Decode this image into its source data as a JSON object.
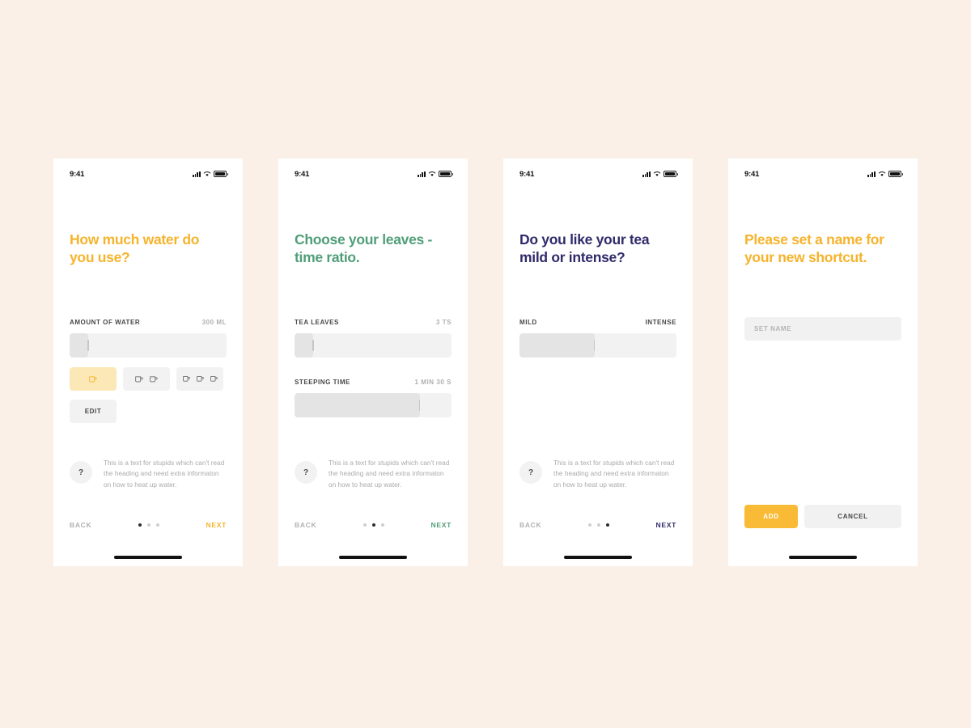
{
  "background_color": "#FBF0E8",
  "colors": {
    "amber": "#F6B32C",
    "green": "#4F9E78",
    "navy": "#302B6B",
    "selected_cup_bg": "#FCE8B6",
    "track": "#F2F2F2",
    "fill": "#E4E4E4"
  },
  "status_bar": {
    "time": "9:41"
  },
  "help_text": "This is a text for stupids which can't read the heading and need extra informaton on how to heat up water.",
  "help_badge": "?",
  "screens": [
    {
      "id": "water-amount",
      "accent": "#F6B32C",
      "heading": "How much water do you use?",
      "fields": [
        {
          "label": "AMOUNT OF WATER",
          "value": "300 ML",
          "fill_percent": 12,
          "thumb_percent": 12
        }
      ],
      "cup_options": [
        {
          "count": 1,
          "selected": true
        },
        {
          "count": 2,
          "selected": false
        },
        {
          "count": 3,
          "selected": false
        }
      ],
      "edit_label": "EDIT",
      "back_label": "BACK",
      "next_label": "NEXT",
      "dots": {
        "total": 3,
        "active_index": 0
      }
    },
    {
      "id": "leaves-time-ratio",
      "accent": "#4F9E78",
      "heading": "Choose your leaves - time ratio.",
      "fields": [
        {
          "label": "TEA LEAVES",
          "value": "3 TS",
          "fill_percent": 12,
          "thumb_percent": 12
        },
        {
          "label": "STEEPING TIME",
          "value": "1 MIN 30 S",
          "fill_percent": 80,
          "thumb_percent": 80
        }
      ],
      "back_label": "BACK",
      "next_label": "NEXT",
      "dots": {
        "total": 3,
        "active_index": 1
      }
    },
    {
      "id": "mild-or-intense",
      "accent": "#302B6B",
      "heading": "Do you like your tea mild or intense?",
      "fields": [
        {
          "label": "MILD",
          "value": "INTENSE",
          "fill_percent": 48,
          "thumb_percent": 48
        }
      ],
      "back_label": "BACK",
      "next_label": "NEXT",
      "dots": {
        "total": 3,
        "active_index": 2
      }
    },
    {
      "id": "name-shortcut",
      "accent": "#F6B32C",
      "heading": "Please set a name for your new shortcut.",
      "name_input": {
        "value": "",
        "placeholder": "SET NAME"
      },
      "add_label": "ADD",
      "cancel_label": "CANCEL"
    }
  ]
}
